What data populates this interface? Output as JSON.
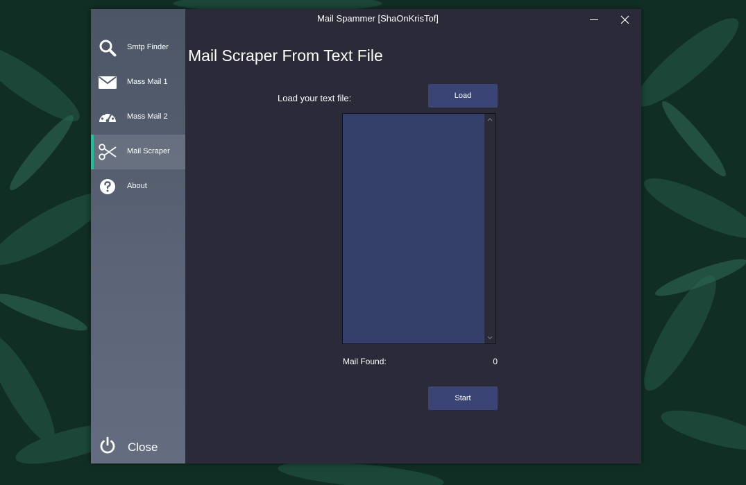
{
  "window": {
    "title": "Mail Spammer [ShaOnKrisTof]"
  },
  "sidebar": {
    "items": [
      {
        "label": "Smtp Finder",
        "icon": "search-icon"
      },
      {
        "label": "Mass Mail 1",
        "icon": "envelope-icon"
      },
      {
        "label": "Mass Mail 2",
        "icon": "dashboard-icon"
      },
      {
        "label": "Mail Scraper",
        "icon": "scissors-icon",
        "active": true
      },
      {
        "label": "About",
        "icon": "question-icon"
      }
    ],
    "close_label": "Close",
    "accent_color": "#1fc29a"
  },
  "main": {
    "heading": "Mail Scraper From Text File",
    "load_label": "Load your text file:",
    "load_button": "Load",
    "textbox_value": "",
    "found_label": "Mail Found:",
    "found_count": "0",
    "start_button": "Start"
  },
  "colors": {
    "window_bg": "#2b2a38",
    "button_bg": "#3b4575",
    "textbox_bg": "#35406a"
  }
}
